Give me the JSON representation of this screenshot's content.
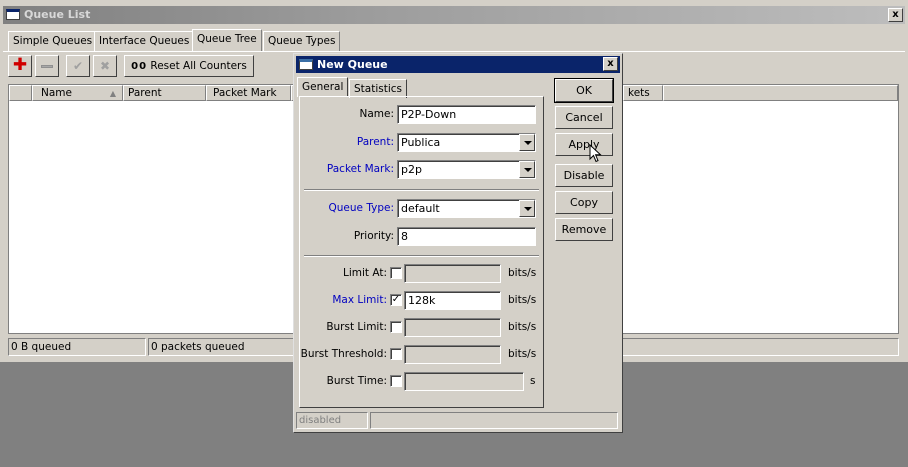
{
  "window": {
    "title": "Queue List",
    "close": "x",
    "tabs": [
      "Simple Queues",
      "Interface Queues",
      "Queue Tree",
      "Queue Types"
    ],
    "reset_counters": "Reset All Counters",
    "reset_counters_prefix": "00",
    "columns": [
      "Name",
      "Parent",
      "Packet Mark",
      "kets"
    ],
    "status": {
      "queued_bytes": "0 B queued",
      "queued_packets": "0 packets queued"
    }
  },
  "dialog": {
    "title": "New Queue",
    "close": "x",
    "tabs": [
      "General",
      "Statistics"
    ],
    "fields": {
      "name": {
        "label": "Name:",
        "value": "P2P-Down"
      },
      "parent": {
        "label": "Parent:",
        "value": "Publica"
      },
      "packet_mark": {
        "label": "Packet Mark:",
        "value": "p2p"
      },
      "queue_type": {
        "label": "Queue Type:",
        "value": "default"
      },
      "priority": {
        "label": "Priority:",
        "value": "8"
      },
      "limit_at": {
        "label": "Limit At:",
        "value": "",
        "unit": "bits/s",
        "checked": false
      },
      "max_limit": {
        "label": "Max Limit:",
        "value": "128k",
        "unit": "bits/s",
        "checked": true
      },
      "burst_limit": {
        "label": "Burst Limit:",
        "value": "",
        "unit": "bits/s",
        "checked": false
      },
      "burst_threshold": {
        "label": "Burst Threshold:",
        "value": "",
        "unit": "bits/s",
        "checked": false
      },
      "burst_time": {
        "label": "Burst Time:",
        "value": "",
        "unit": "s",
        "checked": false
      }
    },
    "buttons": {
      "ok": "OK",
      "cancel": "Cancel",
      "apply": "Apply",
      "disable": "Disable",
      "copy": "Copy",
      "remove": "Remove"
    },
    "status": "disabled",
    "check_mark": "✓"
  }
}
